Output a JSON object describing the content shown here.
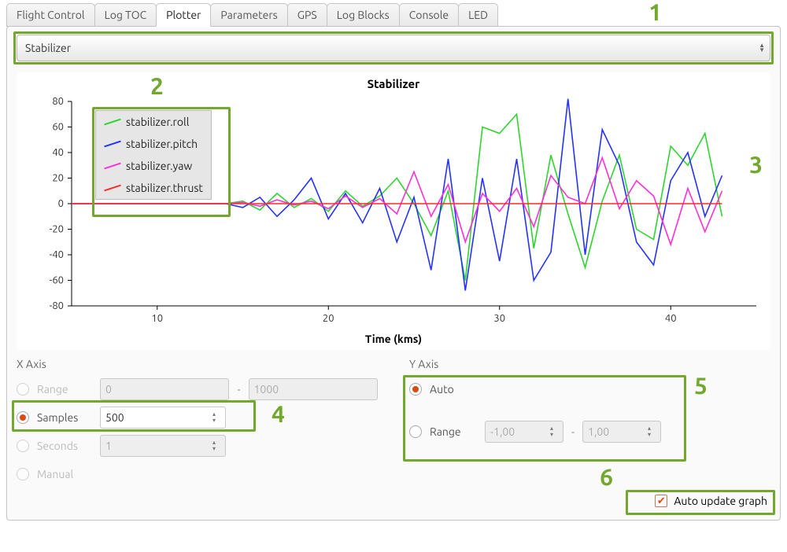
{
  "tabs": [
    {
      "label": "Flight Control"
    },
    {
      "label": "Log TOC"
    },
    {
      "label": "Plotter",
      "active": true
    },
    {
      "label": "Parameters"
    },
    {
      "label": "GPS"
    },
    {
      "label": "Log Blocks"
    },
    {
      "label": "Console"
    },
    {
      "label": "LED"
    }
  ],
  "dropdown": {
    "value": "Stabilizer"
  },
  "chart_data": {
    "type": "line",
    "title": "Stabilizer",
    "xlabel": "Time (kms)",
    "ylabel": "",
    "xlim": [
      5,
      45
    ],
    "ylim": [
      -80,
      80
    ],
    "xticks": [
      10,
      20,
      30,
      40
    ],
    "yticks": [
      -80,
      -60,
      -40,
      -20,
      0,
      20,
      40,
      60,
      80
    ],
    "legend": [
      {
        "name": "stabilizer.roll",
        "color": "#2fd52f"
      },
      {
        "name": "stabilizer.pitch",
        "color": "#2531ff"
      },
      {
        "name": "stabilizer.yaw",
        "color": "#ff2fd6"
      },
      {
        "name": "stabilizer.thrust",
        "color": "#ff2a2a"
      }
    ],
    "x": [
      5,
      6,
      7,
      8,
      9,
      10,
      11,
      12,
      13,
      14,
      15,
      16,
      17,
      18,
      19,
      20,
      21,
      22,
      23,
      24,
      25,
      26,
      27,
      28,
      29,
      30,
      31,
      32,
      33,
      34,
      35,
      36,
      37,
      38,
      39,
      40,
      41,
      42,
      43
    ],
    "series": [
      {
        "name": "stabilizer.roll",
        "color": "#2fd52f",
        "values": [
          0,
          0,
          0,
          0,
          0,
          0,
          0,
          0,
          0,
          0,
          2,
          -5,
          8,
          -3,
          4,
          -6,
          10,
          -2,
          6,
          20,
          0,
          -25,
          10,
          -60,
          60,
          55,
          70,
          -35,
          38,
          -8,
          -50,
          2,
          38,
          -20,
          -28,
          45,
          30,
          55,
          -10
        ]
      },
      {
        "name": "stabilizer.pitch",
        "color": "#2531ff",
        "values": [
          0,
          0,
          0,
          0,
          0,
          0,
          0,
          0,
          0,
          0,
          -3,
          5,
          -10,
          3,
          20,
          -12,
          8,
          -15,
          12,
          -30,
          5,
          -52,
          35,
          -68,
          20,
          -45,
          35,
          -60,
          -38,
          82,
          -40,
          58,
          30,
          -30,
          -48,
          18,
          40,
          -10,
          22
        ]
      },
      {
        "name": "stabilizer.yaw",
        "color": "#ff2fd6",
        "values": [
          0,
          0,
          0,
          0,
          0,
          0,
          0,
          0,
          0,
          0,
          1,
          -2,
          3,
          -1,
          2,
          -4,
          6,
          -3,
          4,
          -8,
          25,
          -10,
          15,
          -30,
          8,
          -6,
          12,
          -18,
          22,
          5,
          0,
          36,
          -4,
          18,
          6,
          -32,
          12,
          -22,
          10
        ]
      },
      {
        "name": "stabilizer.thrust",
        "color": "#ff2a2a",
        "values": [
          0,
          0,
          0,
          0,
          0,
          0,
          0,
          0,
          0,
          0,
          0,
          0,
          0,
          0,
          0,
          0,
          0,
          0,
          0,
          0,
          0,
          0,
          0,
          0,
          0,
          0,
          0,
          0,
          0,
          0,
          0,
          0,
          0,
          0,
          0,
          0,
          0,
          0,
          0
        ]
      }
    ]
  },
  "x_axis": {
    "heading": "X Axis",
    "options": {
      "range": {
        "label": "Range",
        "selected": false
      },
      "samples": {
        "label": "Samples",
        "selected": true
      },
      "seconds": {
        "label": "Seconds",
        "selected": false
      },
      "manual": {
        "label": "Manual",
        "selected": false
      }
    },
    "range_from": "0",
    "range_to": "1000",
    "samples_value": "500",
    "seconds_value": "1"
  },
  "y_axis": {
    "heading": "Y Axis",
    "options": {
      "auto": {
        "label": "Auto",
        "selected": true
      },
      "range": {
        "label": "Range",
        "selected": false
      }
    },
    "range_from": "-1,00",
    "range_to": "1,00"
  },
  "auto_update": {
    "label": "Auto update graph",
    "checked": true
  },
  "annotations": {
    "1": "1",
    "2": "2",
    "3": "3",
    "4": "4",
    "5": "5",
    "6": "6"
  }
}
